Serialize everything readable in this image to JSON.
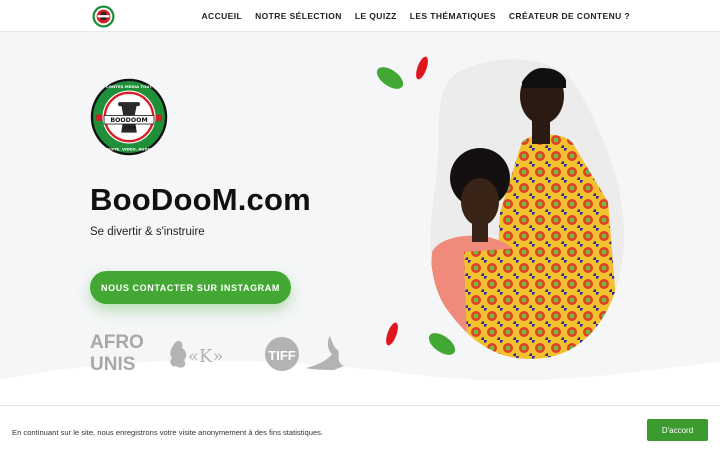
{
  "header": {
    "logo_alt": "BooDooM.com logo",
    "nav": [
      {
        "label": "ACCUEIL"
      },
      {
        "label": "NOTRE SÉLECTION"
      },
      {
        "label": "LE QUIZZ"
      },
      {
        "label": "LES THÉMATIQUES"
      },
      {
        "label": "CRÉATEUR DE CONTENU ?"
      }
    ]
  },
  "hero": {
    "title": "BooDooM.com",
    "subtitle": "Se divertir & s'instruire",
    "cta_label": "NOUS CONTACTER SUR INSTAGRAM",
    "logo": {
      "top_text": "CONTES MEDIA TOUT",
      "center_text": "BOODOOM",
      "sub_text": ".COM",
      "bottom_text": "TEXTE. VIDEO. AUDIO"
    },
    "partners": [
      {
        "name": "AFRO UNIS",
        "line1": "AFRO",
        "line2": "UNIS"
      },
      {
        "name": "K",
        "text": "«K»"
      },
      {
        "name": "TIFF",
        "text": "TIFF"
      },
      {
        "name": "dancer"
      }
    ]
  },
  "cookie": {
    "text": "En continuant sur le site, nous enregistrons votre visite anonymement à des fins statistiques.",
    "button": "D'accord"
  },
  "colors": {
    "accent_green": "#43a833",
    "leaf_red": "#e0161f",
    "header_bg": "#ffffff",
    "hero_bg": "#f5f6f8"
  }
}
